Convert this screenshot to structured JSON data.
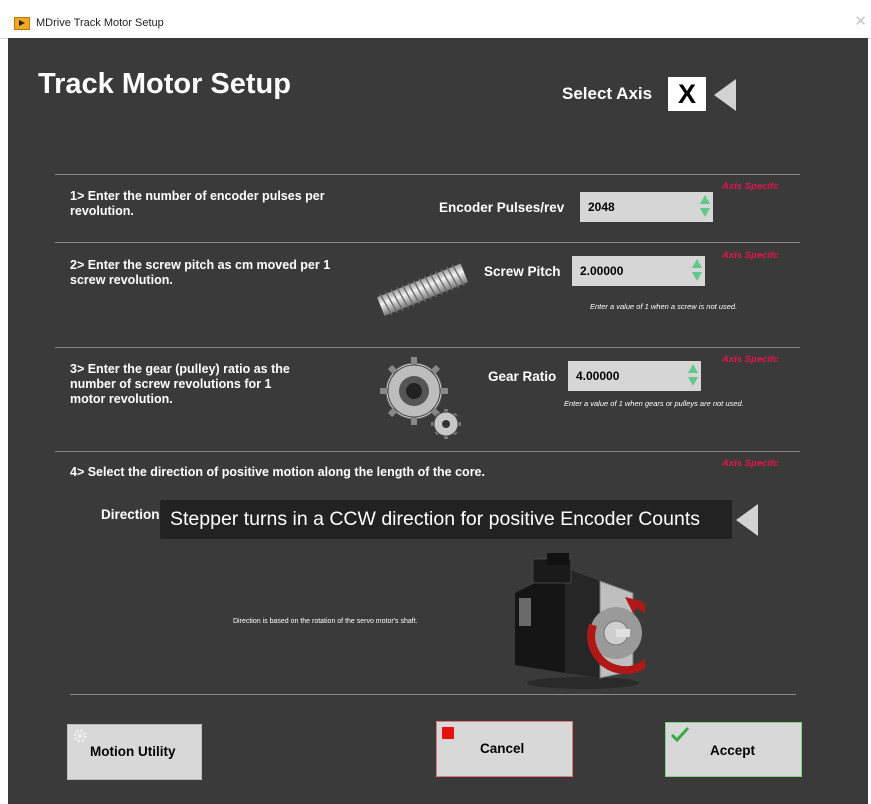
{
  "window": {
    "title": "MDrive Track Motor Setup",
    "close_glyph": "✕"
  },
  "page_title": "Track Motor Setup",
  "axis": {
    "label": "Select Axis",
    "value": "X"
  },
  "axis_specific_label": "Axis Specifc",
  "step1": {
    "text_line1": "1> Enter the number of encoder pulses per",
    "text_line2": "revolution.",
    "field_label": "Encoder Pulses/rev",
    "value": "2048"
  },
  "step2": {
    "text_line1": "2> Enter the screw pitch as cm moved per 1",
    "text_line2": "screw revolution.",
    "field_label": "Screw Pitch",
    "value": "2.00000",
    "note": "Enter a value of 1 when a screw is not used."
  },
  "step3": {
    "text_line1": "3> Enter the gear (pulley) ratio as the",
    "text_line2": "number of screw revolutions for 1",
    "text_line3": "motor revolution.",
    "field_label": "Gear Ratio",
    "value": "4.00000",
    "note": "Enter a value of 1 when gears or pulleys are not used."
  },
  "step4": {
    "text": "4> Select the direction of positive motion along the length of the core.",
    "direction_label": "Direction",
    "direction_value": "Stepper turns in a CCW direction for positive Encoder Counts",
    "note": "Direction is based on the rotation of the servo motor's shaft."
  },
  "buttons": {
    "motion_utility": "Motion Utility",
    "cancel": "Cancel",
    "accept": "Accept"
  },
  "colors": {
    "panel_bg": "#3a3a3a",
    "axis_specific": "#e0164a",
    "spinner": "#5fc88a",
    "cancel_icon": "#e8100c",
    "accept_border": "#7fd67f"
  },
  "icons": [
    "labview-app-icon",
    "close-icon",
    "axis-dropdown-arrow-icon",
    "spinner-icon",
    "screw-image-icon",
    "gear-image-icon",
    "direction-dropdown-arrow-icon",
    "servo-motor-image-icon",
    "motion-utility-icon",
    "cancel-stop-icon",
    "accept-check-icon"
  ]
}
